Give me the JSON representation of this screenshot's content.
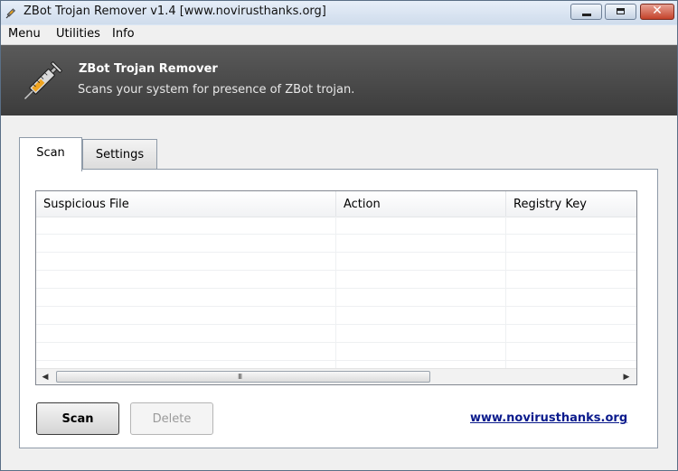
{
  "window": {
    "title": "ZBot Trojan Remover v1.4 [www.novirusthanks.org]",
    "controls": {
      "close_glyph": "✕"
    }
  },
  "menubar": {
    "items": [
      "Menu",
      "Utilities",
      "Info"
    ]
  },
  "banner": {
    "title": "ZBot Trojan Remover",
    "subtitle": "Scans your system for presence of ZBot trojan.",
    "icon": "syringe-icon"
  },
  "tabs": [
    {
      "label": "Scan",
      "active": true
    },
    {
      "label": "Settings",
      "active": false
    }
  ],
  "results_table": {
    "columns": [
      "Suspicious File",
      "Action",
      "Registry Key"
    ],
    "rows": []
  },
  "scrollbar": {
    "left_arrow": "◀",
    "right_arrow": "▶",
    "grip": "III"
  },
  "buttons": {
    "scan": "Scan",
    "delete": "Delete",
    "delete_enabled": false
  },
  "footer_link": "www.novirusthanks.org",
  "colors": {
    "link": "#0a1a8c",
    "banner_bg": "#4a4a4a"
  }
}
